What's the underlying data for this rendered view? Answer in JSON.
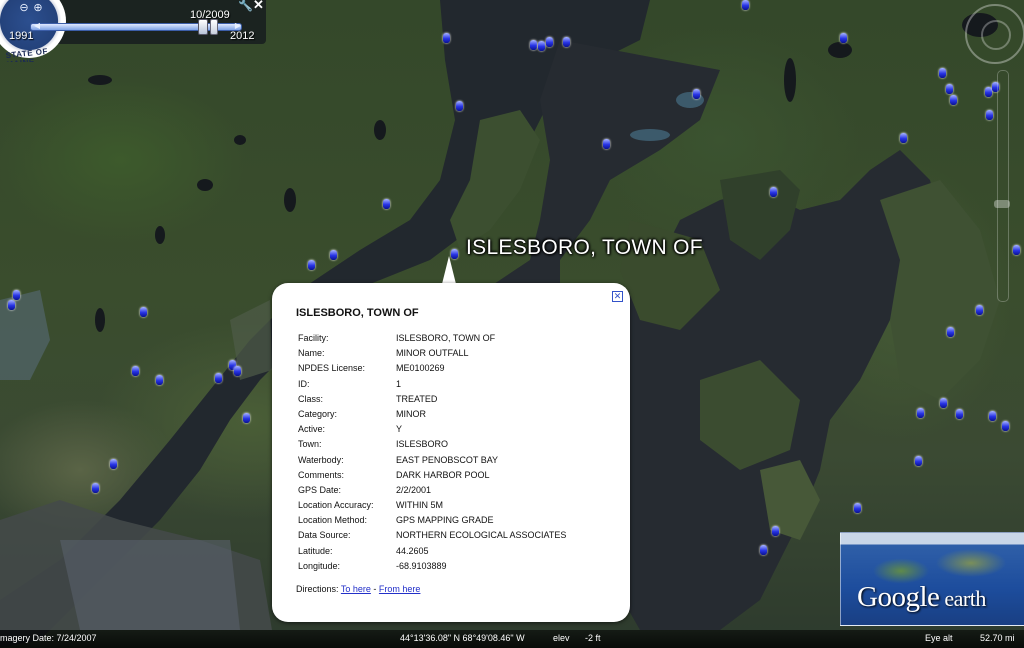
{
  "time_slider": {
    "current_date": "10/2009",
    "start_year": "1991",
    "end_year": "2012",
    "position_fraction": 0.82
  },
  "seal": {
    "text": "STATE OF MAINE"
  },
  "map": {
    "place_label": "ISLESBORO, TOWN OF"
  },
  "balloon": {
    "title": "ISLESBORO, TOWN OF",
    "close_icon": "close-box-icon",
    "fields": [
      {
        "key": "Facility:",
        "value": "ISLESBORO, TOWN OF"
      },
      {
        "key": "Name:",
        "value": "MINOR OUTFALL"
      },
      {
        "key": "NPDES License:",
        "value": "ME0100269"
      },
      {
        "key": "ID:",
        "value": "1"
      },
      {
        "key": "Class:",
        "value": "TREATED"
      },
      {
        "key": "Category:",
        "value": "MINOR"
      },
      {
        "key": "Active:",
        "value": "Y"
      },
      {
        "key": "Town:",
        "value": "ISLESBORO"
      },
      {
        "key": "Waterbody:",
        "value": "EAST PENOBSCOT BAY"
      },
      {
        "key": "Comments:",
        "value": "DARK HARBOR POOL"
      },
      {
        "key": "GPS Date:",
        "value": "2/2/2001"
      },
      {
        "key": "Location Accuracy:",
        "value": "WITHIN 5M"
      },
      {
        "key": "Location Method:",
        "value": "GPS MAPPING GRADE"
      },
      {
        "key": "Data Source:",
        "value": "NORTHERN ECOLOGICAL ASSOCIATES"
      },
      {
        "key": "Latitude:",
        "value": "44.2605"
      },
      {
        "key": "Longitude:",
        "value": "-68.9103889"
      }
    ],
    "directions_label": "Directions:",
    "to_here": "To here",
    "separator": "-",
    "from_here": "From here"
  },
  "logo": {
    "part1": "Google",
    "part2": " earth"
  },
  "status_bar": {
    "imagery_date": "magery Date: 7/24/2007",
    "coordinates": "44°13'36.08\" N   68°49'08.46\" W",
    "elev_label": "elev",
    "elev_value": "-2 ft",
    "eye_alt_label": "Eye alt",
    "eye_alt_value": "52.70 mi"
  },
  "colors": {
    "water": "#23292f",
    "marker": "#2733e6",
    "link": "#2330c9"
  }
}
